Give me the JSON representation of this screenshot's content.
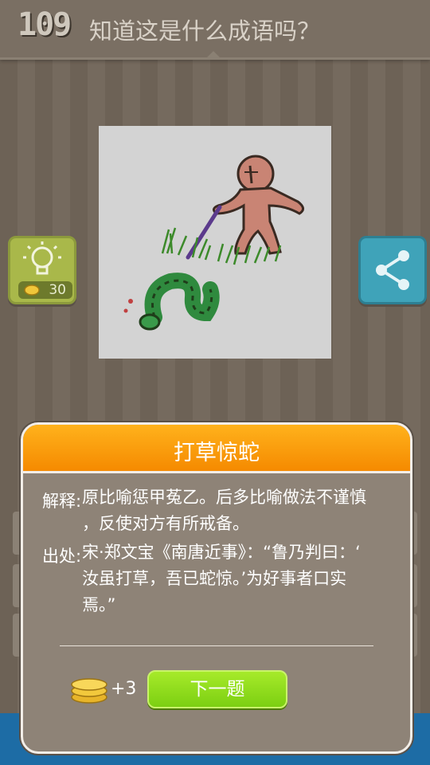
{
  "header": {
    "level": "109",
    "question": "知道这是什么成语吗？"
  },
  "hint": {
    "icon": "lightbulb-icon",
    "cost": "30",
    "color": "#a9b84a"
  },
  "share": {
    "icon": "share-icon",
    "color": "#3fa3b9"
  },
  "puzzle": {
    "image": "person-with-stick-beating-grass-and-snake-illustration"
  },
  "dialog": {
    "title": "打草惊蛇",
    "explanation_label": "解释:",
    "explanation_line1": "原比喻惩甲菟乙。后多比喻做法不谨慎",
    "explanation_line2": "，反使对方有所戒备。",
    "source_label": "出处:",
    "source_line1": "宋·郑文宝《南唐近事》：“鲁乃判曰：‘",
    "source_line2": "汝虽打草，吾已蛇惊。’为好事者口实",
    "source_line3": "焉。”",
    "reward": "+3",
    "next_label": "下一题",
    "header_color": "#f58a00",
    "button_color": "#7ccf12"
  }
}
